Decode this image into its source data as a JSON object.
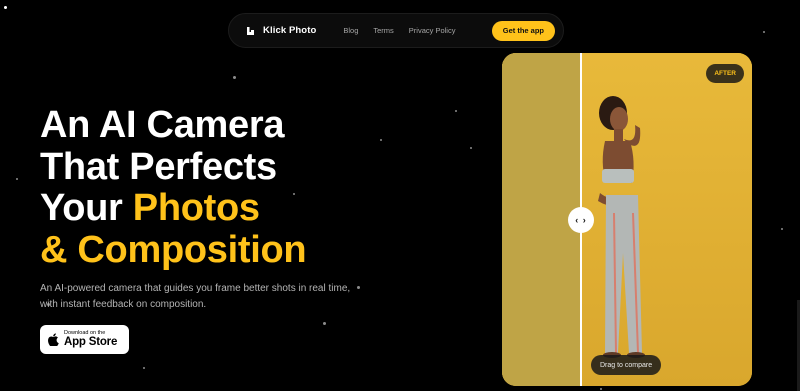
{
  "nav": {
    "brand": "Klick Photo",
    "links": [
      "Blog",
      "Terms",
      "Privacy Policy"
    ],
    "cta": "Get the app"
  },
  "hero": {
    "headline_lines": [
      "An AI Camera",
      "That Perfects",
      "Your ",
      "Photos",
      "& Composition"
    ],
    "subtitle": "An AI-powered camera that guides you frame better shots in real time, with instant feedback on composition.",
    "appstore_small": "Download on the",
    "appstore_big": "App Store"
  },
  "compare": {
    "after_label": "AFTER",
    "handle_glyph": "‹ ›",
    "drag_label": "Drag to compare",
    "divider_position": 0.32
  },
  "colors": {
    "accent": "#ffc21a",
    "background": "#000000",
    "photo_bg": "#e6b73a"
  },
  "icons": [
    "logo-icon",
    "apple-icon",
    "drag-arrows-icon"
  ]
}
